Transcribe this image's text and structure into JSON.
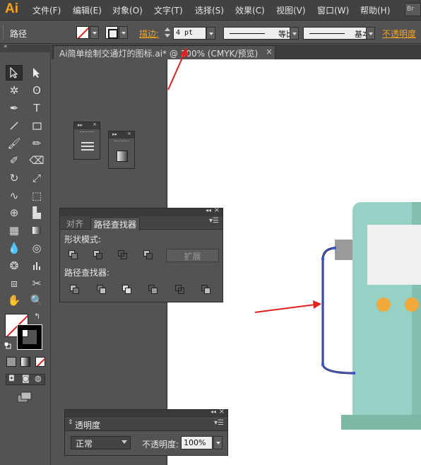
{
  "app": {
    "logo": "Ai"
  },
  "menu": [
    "文件(F)",
    "编辑(E)",
    "对象(O)",
    "文字(T)",
    "选择(S)",
    "效果(C)",
    "视图(V)",
    "窗口(W)",
    "帮助(H)"
  ],
  "menu_extra": "Br",
  "control_bar": {
    "selection_type": "路径",
    "stroke_label": "描边:",
    "stroke_weight": "4 pt",
    "profile_1": "等比",
    "profile_2": "基本",
    "opacity_label": "不透明度"
  },
  "document": {
    "tab_title": "Ai简单绘制交通灯的图标.ai* @ 100% (CMYK/预览)",
    "close": "×"
  },
  "tools": [
    "selection-icon",
    "direct-selection-icon",
    "magic-wand-icon",
    "lasso-icon",
    "pen-icon",
    "type-icon",
    "line-icon",
    "rectangle-icon",
    "paintbrush-icon",
    "pencil-icon",
    "blob-brush-icon",
    "eraser-icon",
    "rotate-icon",
    "scale-icon",
    "warp-icon",
    "free-transform-icon",
    "shape-builder-icon",
    "perspective-grid-icon",
    "mesh-icon",
    "gradient-icon",
    "eyedropper-icon",
    "blend-icon",
    "symbol-sprayer-icon",
    "column-graph-icon",
    "artboard-icon",
    "slice-icon",
    "hand-icon",
    "zoom-icon"
  ],
  "pathfinder_panel": {
    "tab_align": "对齐",
    "tab_pathfinder": "路径查找器",
    "shape_modes_label": "形状模式:",
    "expand_button": "扩展",
    "pathfinders_label": "路径查找器:"
  },
  "transparency_panel": {
    "title": "透明度",
    "blend_mode": "正常",
    "opacity_label": "不透明度:",
    "opacity_value": "100%"
  },
  "colors": {
    "accent_orange": "#f7a21b",
    "traffic_light_body": "#95d1c4",
    "traffic_light_lamp": "#f0a93a",
    "annotation_arrow": "#e02020",
    "selected_path": "#1a1f6e"
  }
}
